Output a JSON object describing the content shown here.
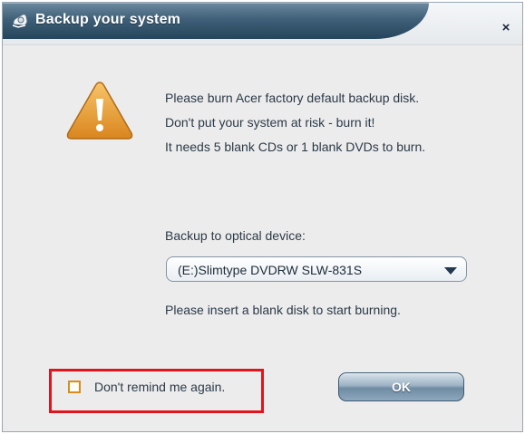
{
  "window": {
    "title": "Backup your system",
    "close_label": "×"
  },
  "message": {
    "line1": "Please burn Acer factory default backup disk.",
    "line2": "Don't put your system at risk - burn it!",
    "line3": "It needs 5 blank CDs or 1 blank DVDs to burn."
  },
  "device": {
    "label": "Backup to optical device:",
    "selected": "(E:)Slimtype DVDRW SLW-831S"
  },
  "instructions": "Please insert a blank disk to start burning.",
  "remind": {
    "label": "Don't remind me again.",
    "checked": false
  },
  "ok_label": "OK",
  "colors": {
    "title_bar": "#3f6078",
    "highlight_border": "#e0141c",
    "warning": "#e8a33a",
    "checkbox_border": "#d98c1c"
  },
  "icons": {
    "title": "backup-disc-icon",
    "warning": "warning-triangle-icon"
  }
}
